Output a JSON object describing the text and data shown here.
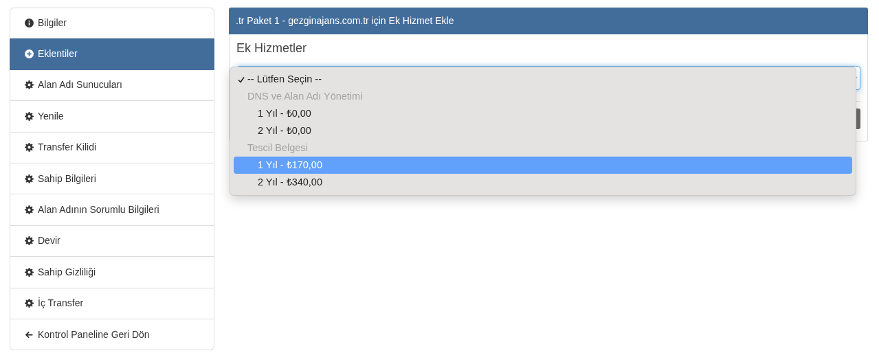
{
  "sidebar": {
    "items": [
      {
        "kind": "info",
        "label": "Bilgiler",
        "selected": false
      },
      {
        "kind": "plus",
        "label": "Eklentiler",
        "selected": true
      },
      {
        "kind": "gear",
        "label": "Alan Adı Sunucuları",
        "selected": false
      },
      {
        "kind": "gear",
        "label": "Yenile",
        "selected": false
      },
      {
        "kind": "gear",
        "label": "Transfer Kilidi",
        "selected": false
      },
      {
        "kind": "gear",
        "label": "Sahip Bilgileri",
        "selected": false
      },
      {
        "kind": "gear",
        "label": "Alan Adının Sorumlu Bilgileri",
        "selected": false
      },
      {
        "kind": "gear",
        "label": "Devir",
        "selected": false
      },
      {
        "kind": "gear",
        "label": "Sahip Gizliliği",
        "selected": false
      },
      {
        "kind": "gear",
        "label": "İç Transfer",
        "selected": false
      },
      {
        "kind": "back",
        "label": "Kontrol Paneline Geri Dön",
        "selected": false
      }
    ]
  },
  "panel": {
    "title": ".tr Paket 1 - gezginajans.com.tr için Ek Hizmet Ekle",
    "heading": "Ek Hizmetler",
    "dropdown": {
      "items": [
        {
          "kind": "option",
          "label": "-- Lütfen Seçin --",
          "checked": true,
          "selected": false
        },
        {
          "kind": "group",
          "label": "DNS ve Alan Adı Yönetimi",
          "children": [
            {
              "label": "1 Yıl - ₺0,00",
              "checked": false,
              "selected": false
            },
            {
              "label": "2 Yıl - ₺0,00",
              "checked": false,
              "selected": false
            }
          ]
        },
        {
          "kind": "group",
          "label": "Tescil Belgesi",
          "children": [
            {
              "label": "1 Yıl - ₺170,00",
              "checked": false,
              "selected": true
            },
            {
              "label": "2 Yıl - ₺340,00",
              "checked": false,
              "selected": false
            }
          ]
        }
      ]
    }
  }
}
